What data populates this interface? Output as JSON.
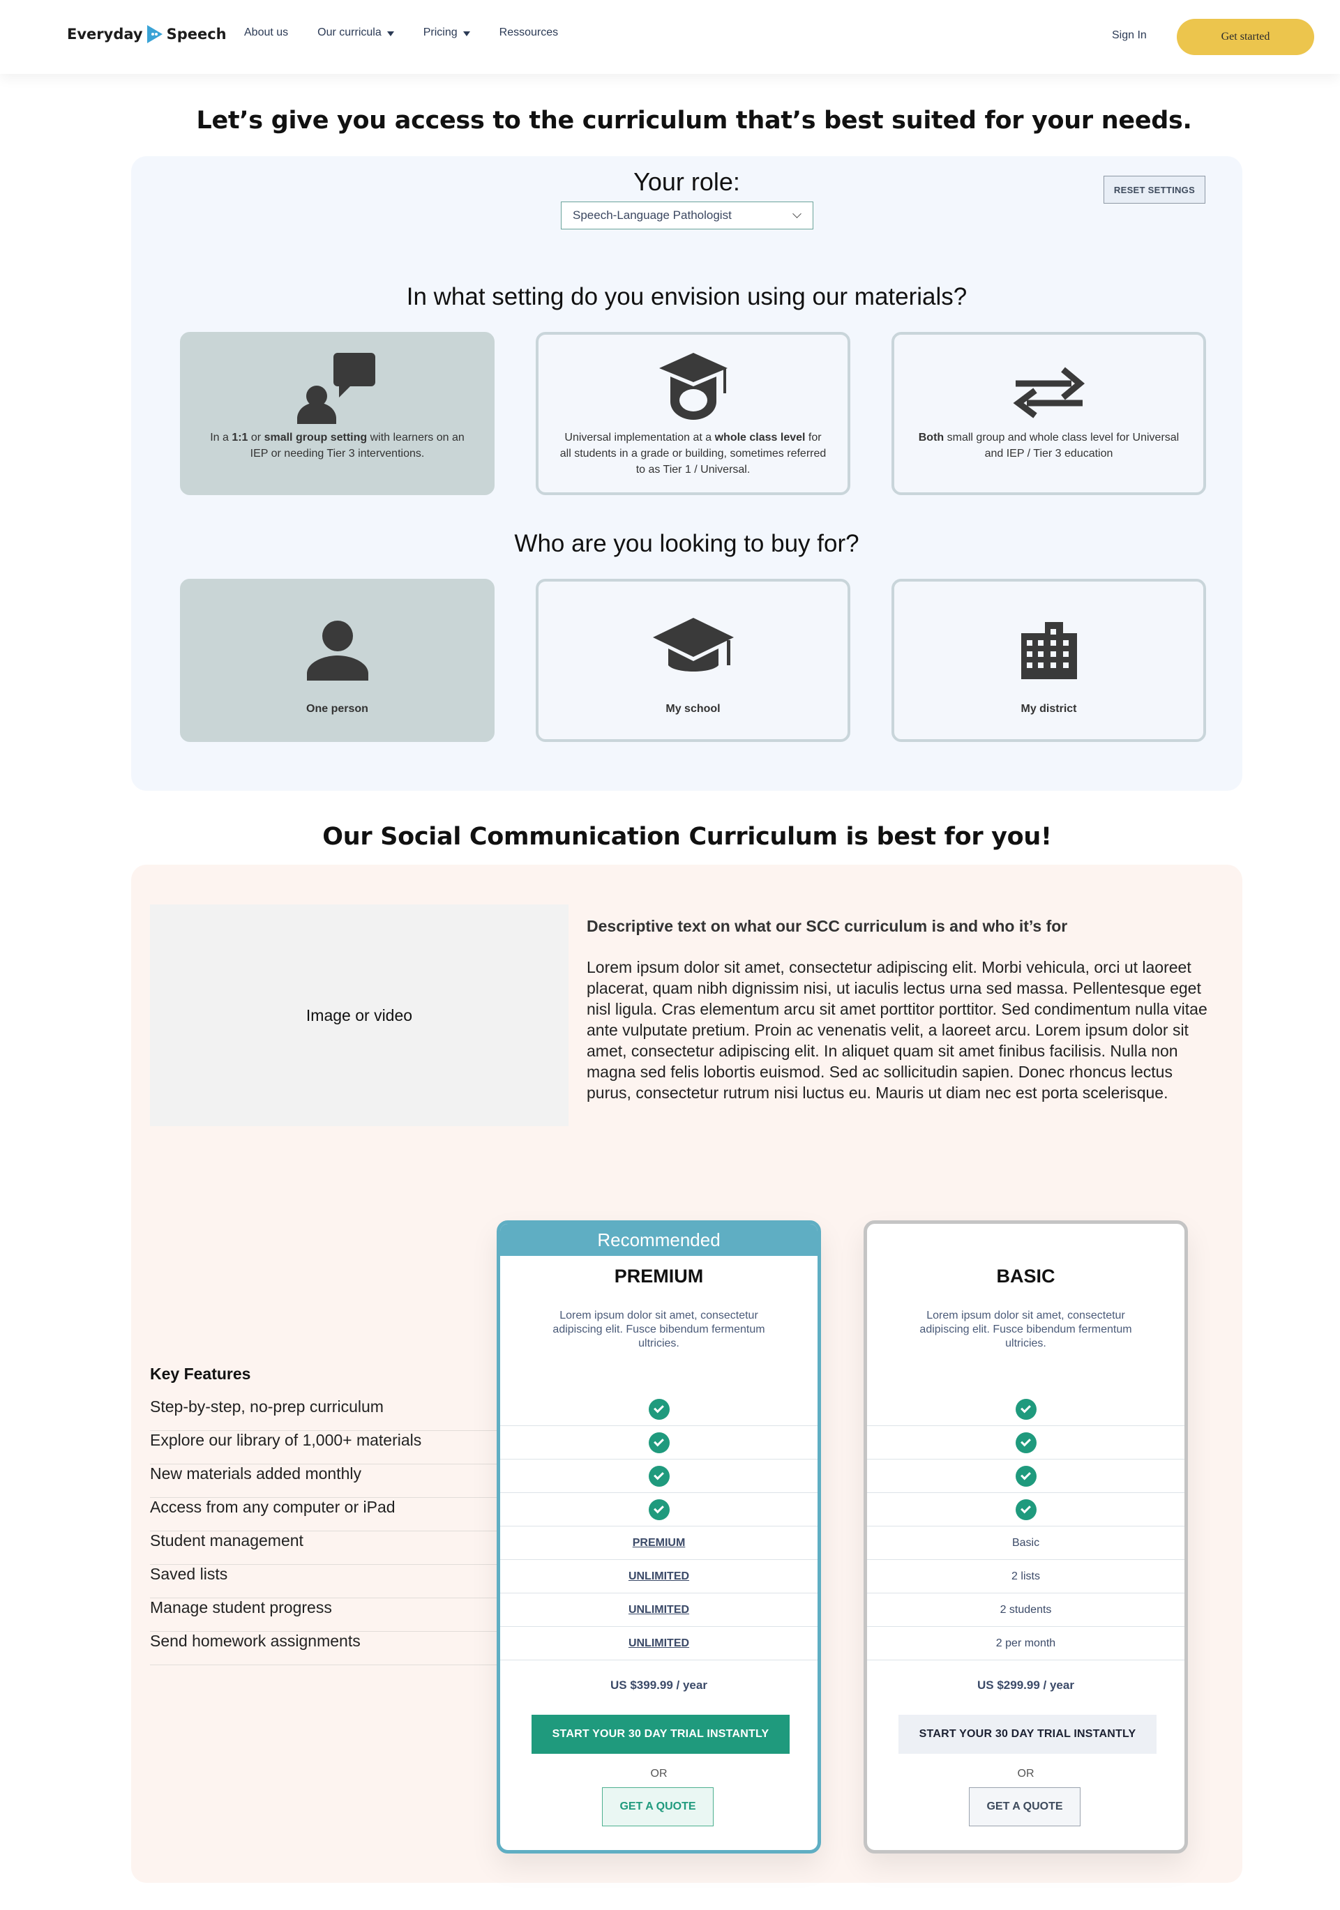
{
  "header": {
    "logo_left": "Everyday",
    "logo_right": "Speech",
    "nav": [
      {
        "label": "About us",
        "has_caret": false
      },
      {
        "label": "Our curricula",
        "has_caret": true
      },
      {
        "label": "Pricing",
        "has_caret": true
      },
      {
        "label": "Ressources",
        "has_caret": false
      }
    ],
    "sign_in": "Sign In",
    "get_started": "Get started"
  },
  "headline": "Let’s give you access to the curriculum that’s best suited for your needs.",
  "selector": {
    "role_label": "Your role:",
    "role_value": "Speech-Language Pathologist",
    "reset_label": "RESET SETTINGS",
    "setting_question": "In what setting do you envision using our materials?",
    "settings": [
      {
        "icon": "speech-bubble-person-icon",
        "pre": "In a ",
        "b1": "1:1",
        "mid": " or ",
        "b2": "small group setting",
        "post": " with learners on an IEP or needing Tier 3 interventions.",
        "selected": true
      },
      {
        "icon": "graduation-cap-student-icon",
        "pre": "Universal implementation at a ",
        "b1": "whole class level",
        "mid": "",
        "b2": "",
        "post": " for all students in a grade or building, sometimes referred to as Tier 1 / Universal.",
        "selected": false
      },
      {
        "icon": "swap-arrows-icon",
        "pre": "",
        "b1": "Both",
        "mid": "",
        "b2": "",
        "post": " small group and whole class level for Universal and IEP / Tier 3 education",
        "selected": false
      }
    ],
    "buy_question": "Who are you looking to buy for?",
    "buyers": [
      {
        "icon": "person-icon",
        "label": "One person",
        "selected": true
      },
      {
        "icon": "school-cap-icon",
        "label": "My school",
        "selected": false
      },
      {
        "icon": "building-icon",
        "label": "My district",
        "selected": false
      }
    ]
  },
  "result": {
    "headline": "Our Social Communication Curriculum is best for you!",
    "media_label": "Image or video",
    "desc_title": "Descriptive text on what our SCC curriculum is and who it’s for",
    "desc_body": "Lorem ipsum dolor sit amet, consectetur adipiscing elit. Morbi vehicula, orci ut laoreet placerat, quam nibh dignissim nisi, ut iaculis lectus urna sed massa. Pellentesque eget nisl ligula. Cras elementum arcu sit amet porttitor porttitor. Sed condimentum nulla vitae ante vulputate pretium. Proin ac venenatis velit, a laoreet arcu. Lorem ipsum dolor sit amet, consectetur adipiscing elit. In aliquet quam sit amet finibus facilisis. Nulla non magna sed felis lobortis euismod. Sed ac sollicitudin sapien. Donec rhoncus lectus purus, consectetur rutrum nisi luctus eu. Mauris ut diam nec est porta scelerisque.",
    "key_features_title": "Key Features",
    "features": [
      "Step-by-step, no-prep curriculum",
      "Explore our library of 1,000+ materials",
      "New materials added monthly",
      "Access from any computer or iPad",
      "Student management",
      "Saved lists",
      "Manage student progress",
      "Send homework assignments"
    ],
    "plans": {
      "premium": {
        "badge": "Recommended",
        "name": "PREMIUM",
        "description": "Lorem ipsum dolor sit amet, consectetur adipiscing elit. Fusce bibendum fermentum ultricies.",
        "values": [
          "check",
          "check",
          "check",
          "check",
          "PREMIUM",
          "UNLIMITED",
          "UNLIMITED",
          "UNLIMITED"
        ],
        "price": "US $399.99 / year",
        "trial": "START YOUR 30 DAY TRIAL INSTANTLY",
        "or": "OR",
        "quote": "GET A QUOTE"
      },
      "basic": {
        "name": "BASIC",
        "description": "Lorem ipsum dolor sit amet, consectetur adipiscing elit. Fusce bibendum fermentum ultricies.",
        "values": [
          "check",
          "check",
          "check",
          "check",
          "Basic",
          "2 lists",
          "2 students",
          "2 per month"
        ],
        "price": "US $299.99 / year",
        "trial": "START YOUR 30 DAY TRIAL INSTANTLY",
        "or": "OR",
        "quote": "GET A QUOTE"
      }
    }
  },
  "colors": {
    "accent_yellow": "#ecc54d",
    "premium_blue": "#5faec3",
    "check_green": "#1f9a7d",
    "selected_card": "#c9d5d6"
  }
}
